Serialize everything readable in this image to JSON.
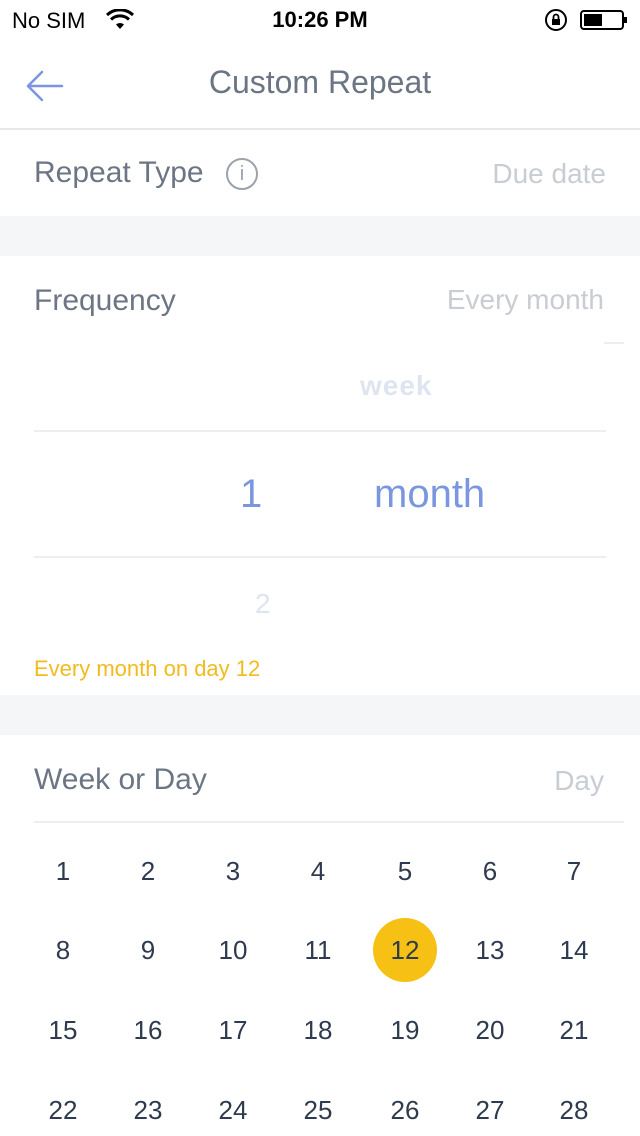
{
  "status": {
    "carrier": "No SIM",
    "time": "10:26 PM"
  },
  "nav": {
    "title": "Custom Repeat"
  },
  "repeat_type": {
    "label": "Repeat Type",
    "info_glyph": "i",
    "value": "Due date"
  },
  "frequency": {
    "label": "Frequency",
    "value": "Every month",
    "picker": {
      "number_above": "",
      "number_selected": "1",
      "number_below": "2",
      "unit_above": "week",
      "unit_selected": "month"
    },
    "note": "Every month on day 12"
  },
  "week_or_day": {
    "label": "Week or Day",
    "value": "Day"
  },
  "calendar": {
    "selected": "12",
    "rows": [
      [
        "1",
        "2",
        "3",
        "4",
        "5",
        "6",
        "7"
      ],
      [
        "8",
        "9",
        "10",
        "11",
        "12",
        "13",
        "14"
      ],
      [
        "15",
        "16",
        "17",
        "18",
        "19",
        "20",
        "21"
      ],
      [
        "22",
        "23",
        "24",
        "25",
        "26",
        "27",
        "28"
      ]
    ]
  },
  "colors": {
    "accent": "#7b96e0",
    "highlight": "#f6c015",
    "text": "#6b7584"
  }
}
